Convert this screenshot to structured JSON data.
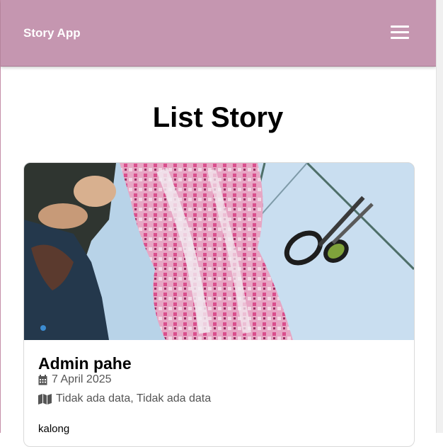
{
  "header": {
    "brand": "Story App",
    "menu_icon": "hamburger-menu-icon",
    "background": "#c596b0"
  },
  "main": {
    "title": "List Story"
  },
  "stories": [
    {
      "name": "Admin pahe",
      "date": "7 April 2025",
      "location": "Tidak ada data, Tidak ada data",
      "description": "kalong"
    }
  ]
}
